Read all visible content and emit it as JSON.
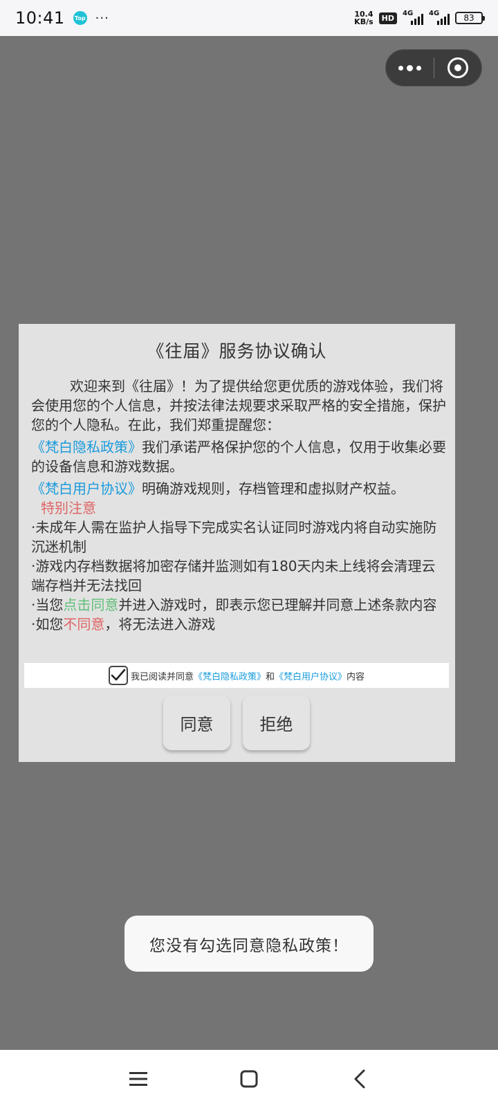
{
  "status_bar": {
    "time": "10:41",
    "app_icon_text": "Top",
    "more": "···",
    "net_speed_value": "10.4",
    "net_speed_unit": "KB/s",
    "hd": "HD",
    "sim1": "4G",
    "sim2": "4G",
    "battery": "83"
  },
  "dialog": {
    "title": "《往届》服务协议确认",
    "intro": "欢迎来到《往届》！为了提供给您更优质的游戏体验，我们将会使用您的个人信息，并按法律法规要求采取严格的安全措施，保护您的个人隐私。在此，我们郑重提醒您：",
    "privacy_link": "《梵白隐私政策》",
    "privacy_text": "我们承诺严格保护您的个人信息，仅用于收集必要的设备信息和游戏数据。",
    "user_link": "《梵白用户协议》",
    "user_text": "明确游戏规则，存档管理和虚拟财产权益。",
    "notice_title": "特别注意",
    "rule1": "·未成年人需在监护人指导下完成实名认证同时游戏内将自动实施防沉迷机制",
    "rule2": "·游戏内存档数据将加密存储并监测如有180天内未上线将会清理云端存档并无法找回",
    "rule3_pre": "·当您",
    "rule3_highlight": "点击同意",
    "rule3_post": "并进入游戏时，即表示您已理解并同意上述条款内容",
    "rule4_pre": "·如您",
    "rule4_highlight": "不同意",
    "rule4_post": "，将无法进入游戏",
    "consent_pre": "我已阅读并同意",
    "consent_privacy": "《梵白隐私政策》",
    "consent_and": "和",
    "consent_user": "《梵白用户协议》",
    "consent_post": "内容",
    "agree_label": "同意",
    "refuse_label": "拒绝"
  },
  "toast": {
    "message": "您没有勾选同意隐私政策！"
  },
  "colors": {
    "overlay": "#747474",
    "link": "#1a9cdc",
    "warning": "#e06464",
    "highlight": "#5fbf78"
  }
}
